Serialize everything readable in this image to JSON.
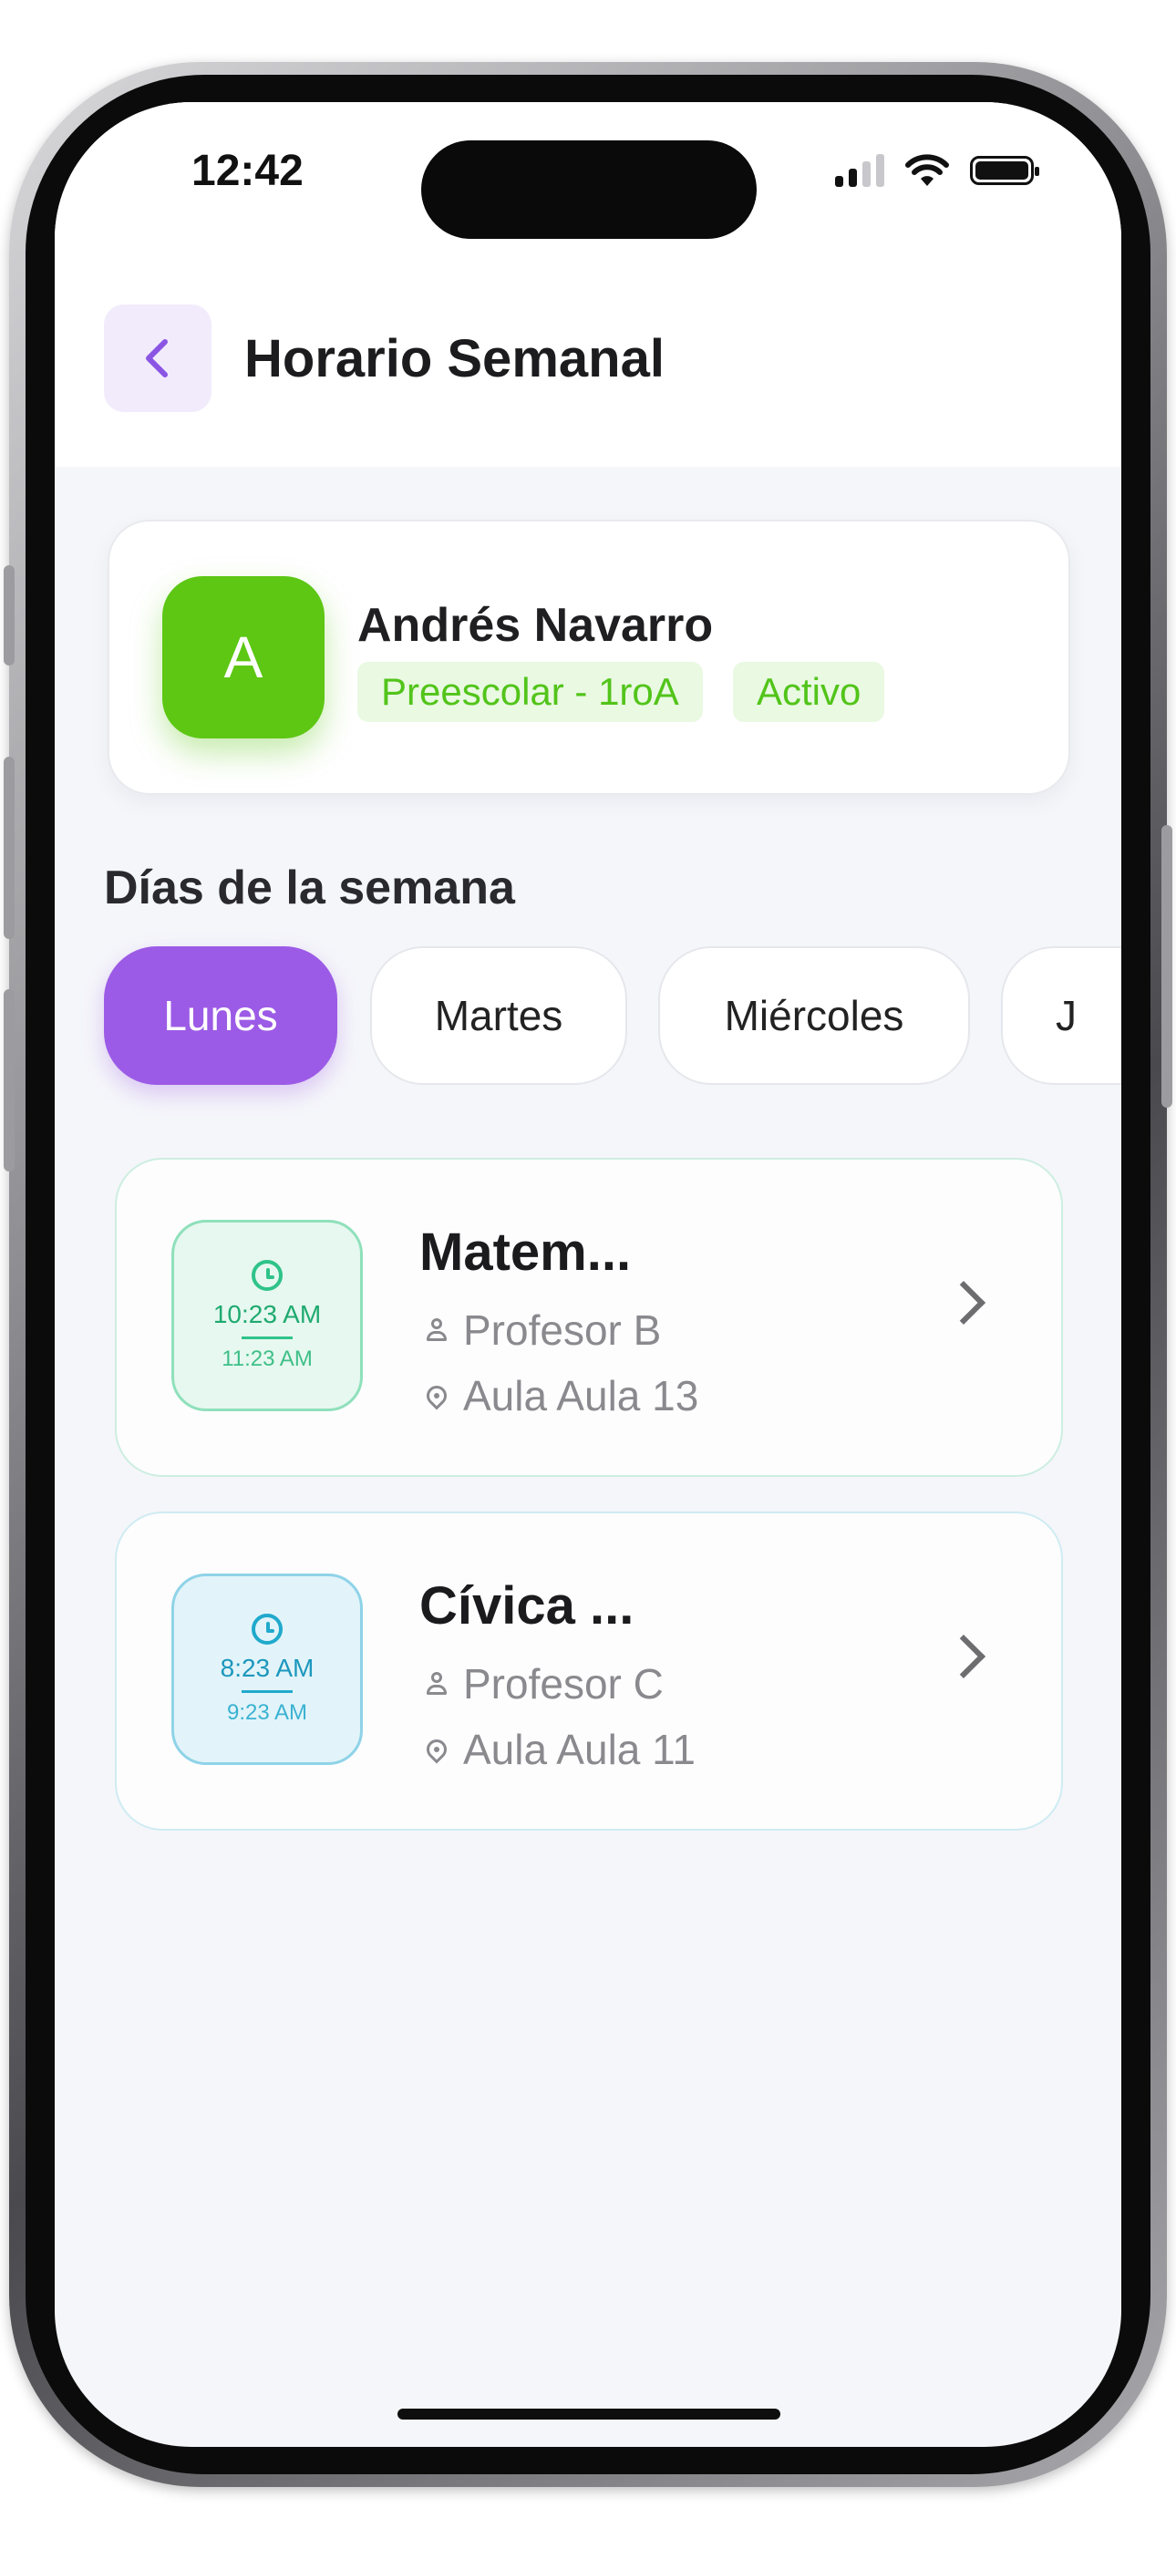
{
  "status_bar": {
    "time": "12:42"
  },
  "header": {
    "back_icon": "chevron-left-icon",
    "title": "Horario Semanal"
  },
  "student": {
    "initial": "A",
    "name": "Andrés Navarro",
    "group": "Preescolar - 1roA",
    "status": "Activo",
    "avatar_color": "#5dc714"
  },
  "days": {
    "title": "Días de la semana",
    "items": [
      "Lunes",
      "Martes",
      "Miércoles",
      "J"
    ],
    "selected": "Lunes",
    "accent_color": "#9c5be6"
  },
  "classes": [
    {
      "title": "Matem...",
      "start": "10:23 AM",
      "end": "11:23 AM",
      "teacher": "Profesor B",
      "room": "Aula Aula 13",
      "color": "#2fc389"
    },
    {
      "title": "Cívica ...",
      "start": "8:23 AM",
      "end": "9:23 AM",
      "teacher": "Profesor C",
      "room": "Aula Aula 11",
      "color": "#20a9cc"
    }
  ]
}
